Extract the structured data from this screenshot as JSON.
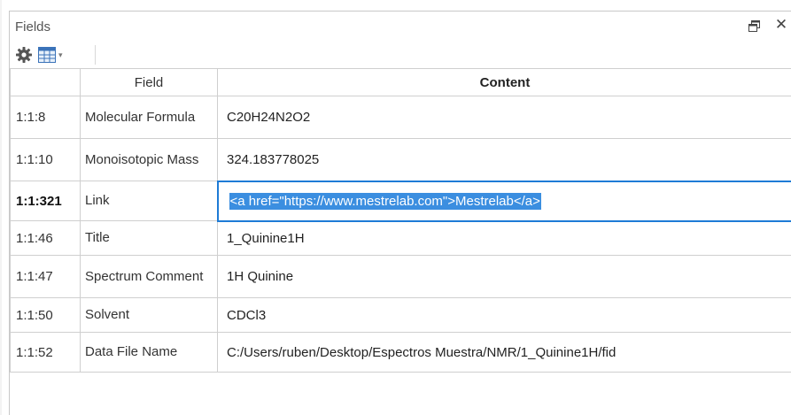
{
  "panel": {
    "title": "Fields",
    "restore_icon": "restore-window-icon",
    "close_label": "✕"
  },
  "toolbar": {
    "gear_icon": "gear-icon",
    "grid_icon": "grid-table-icon",
    "caret_label": "▾"
  },
  "table": {
    "headers": {
      "id": "",
      "field": "Field",
      "content": "Content"
    },
    "rows": [
      {
        "id": "1:1:8",
        "field": "Molecular Formula",
        "content": "C20H24N2O2"
      },
      {
        "id": "1:1:10",
        "field": "Monoisotopic Mass",
        "content": "324.183778025"
      },
      {
        "id": "1:1:321",
        "field": "Link",
        "content": "<a href=\"https://www.mestrelab.com\">Mestrelab</a>"
      },
      {
        "id": "1:1:46",
        "field": "Title",
        "content": "1_Quinine1H"
      },
      {
        "id": "1:1:47",
        "field": "Spectrum Comment",
        "content": "1H Quinine"
      },
      {
        "id": "1:1:50",
        "field": "Solvent",
        "content": "CDCl3"
      },
      {
        "id": "1:1:52",
        "field": "Data File Name",
        "content": "C:/Users/ruben/Desktop/Espectros Muestra/NMR/1_Quinine1H/fid"
      }
    ]
  },
  "colors": {
    "selection": "#3b8ee0",
    "active_border": "#1e7bd6",
    "grid_lines": "#cfcfcf"
  }
}
